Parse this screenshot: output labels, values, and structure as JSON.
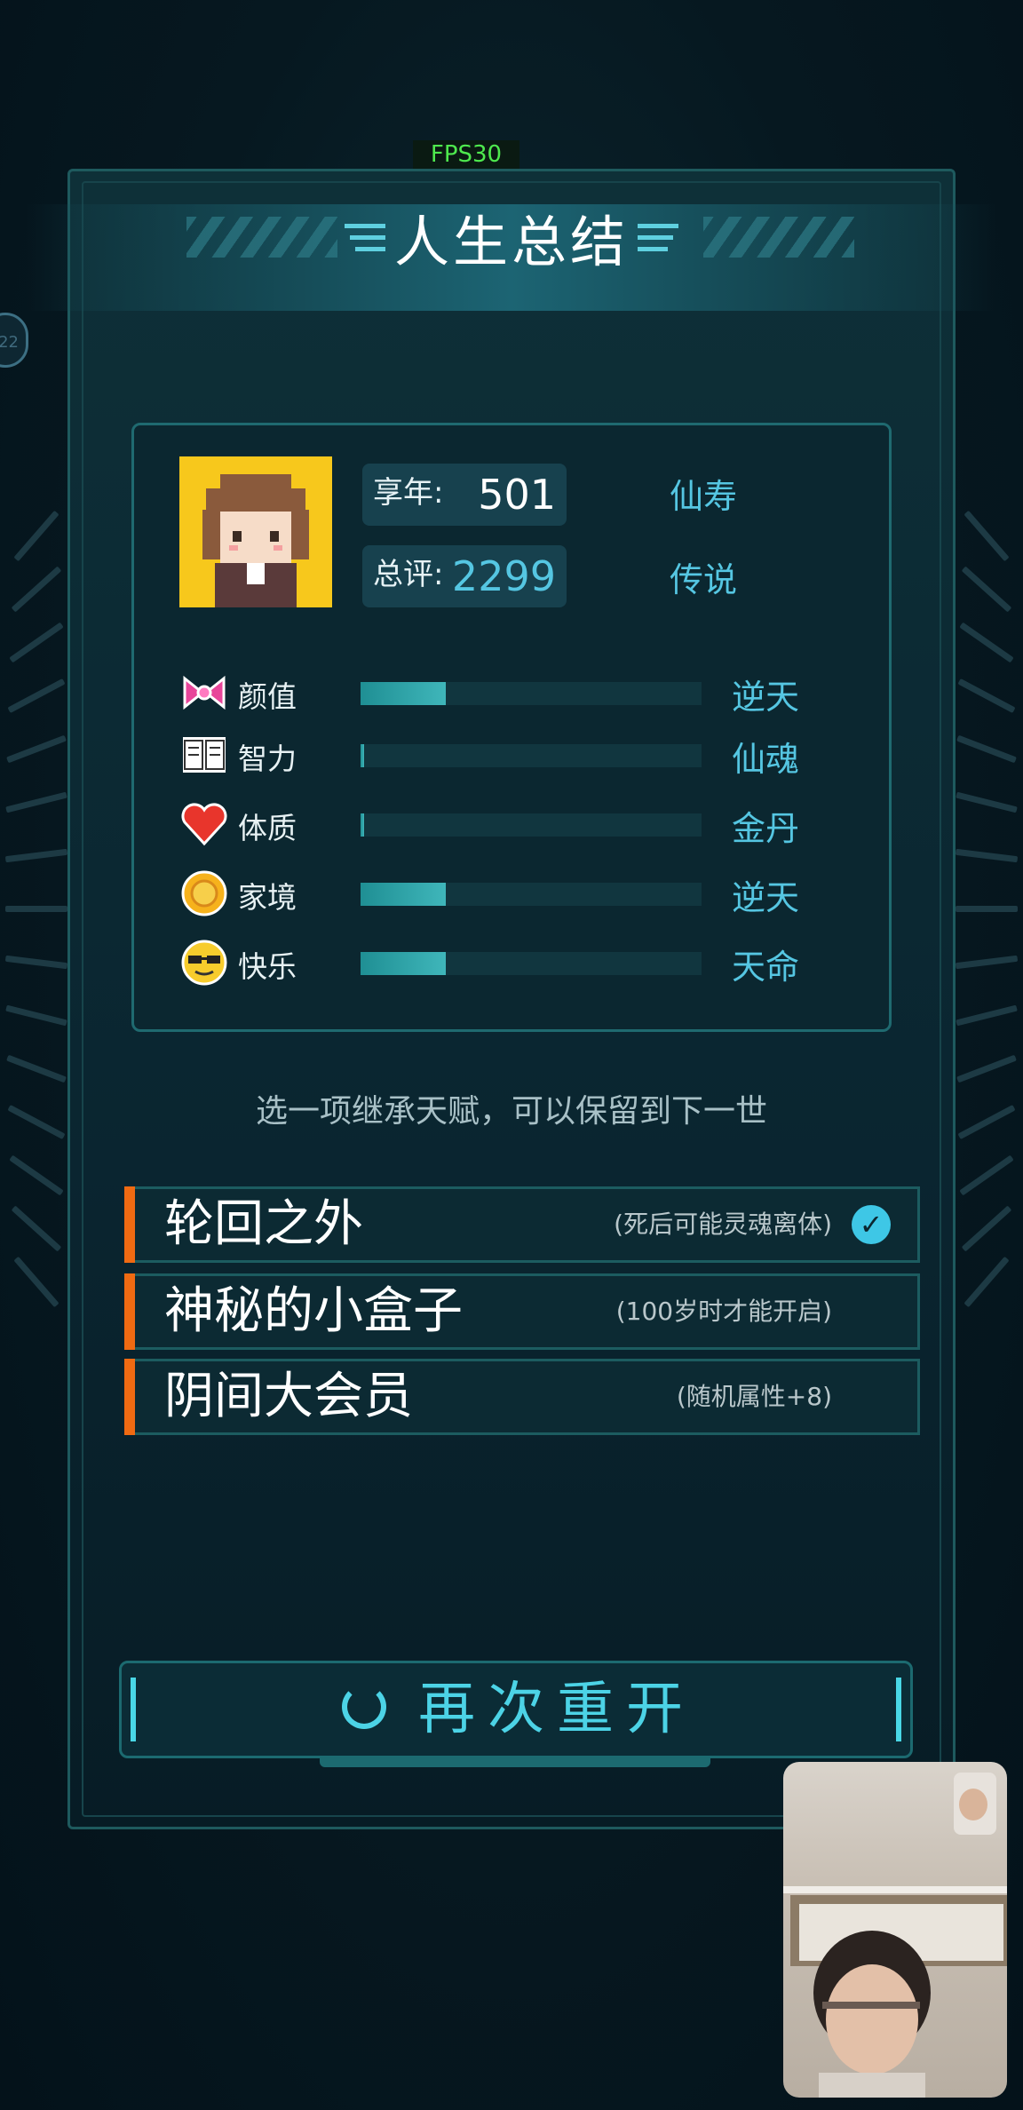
{
  "fps": "FPS30",
  "side_badge": "22",
  "title": "人生总结",
  "summary": {
    "age_label": "享年:",
    "age_value": "501",
    "age_grade": "仙寿",
    "score_label": "总评:",
    "score_value": "2299",
    "score_grade": "传说"
  },
  "attributes": [
    {
      "icon": "bow-icon",
      "label": "颜值",
      "level": 0.25,
      "grade": "逆天"
    },
    {
      "icon": "book-icon",
      "label": "智力",
      "level": 0.01,
      "grade": "仙魂"
    },
    {
      "icon": "heart-icon",
      "label": "体质",
      "level": 0.01,
      "grade": "金丹"
    },
    {
      "icon": "coin-icon",
      "label": "家境",
      "level": 0.25,
      "grade": "逆天"
    },
    {
      "icon": "sunglasses-face-icon",
      "label": "快乐",
      "level": 0.25,
      "grade": "天命"
    }
  ],
  "hint": "选一项继承天赋，可以保留到下一世",
  "talents": [
    {
      "name": "轮回之外",
      "desc": "(死后可能灵魂离体)",
      "selected": true
    },
    {
      "name": "神秘的小盒子",
      "desc": "(100岁时才能开启)",
      "selected": false
    },
    {
      "name": "阴间大会员",
      "desc": "(随机属性+8)",
      "selected": false
    }
  ],
  "restart_label": "再次重开",
  "colors": {
    "accent": "#4cd3e6",
    "talent_accent": "#f06a12",
    "grade": "#55c6e2"
  }
}
